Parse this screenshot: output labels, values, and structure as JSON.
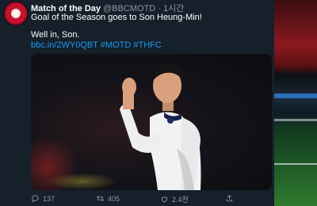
{
  "tweet": {
    "author_name": "Match of the Day",
    "handle": "@BBCMOTD",
    "time": "· 1시간",
    "line1": "Goal of the Season goes to Son Heung-Min!",
    "line2": "Well in, Son.",
    "link_url": "bbc.in/2WY0QBT",
    "hashtag1": "#MOTD",
    "hashtag2": "#THFC"
  },
  "actions": {
    "replies": "137",
    "retweets": "405",
    "likes": "2.4천"
  },
  "icons": [
    "reply-icon",
    "retweet-icon",
    "like-icon",
    "share-icon"
  ],
  "colors": {
    "background": "#15202b",
    "link": "#1d9bf0",
    "muted": "#8b98a5"
  }
}
